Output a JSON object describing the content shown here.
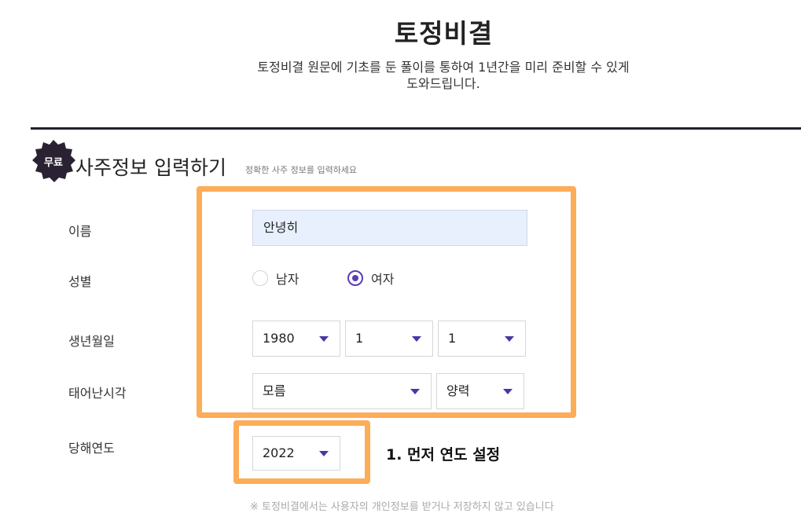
{
  "header": {
    "title": "토정비결",
    "description_line1": "토정비결 원문에 기초를 둔 풀이를 통하여 1년간을 미리 준비할 수 있게",
    "description_line2": "도와드립니다."
  },
  "section": {
    "badge": "무료",
    "title": "사주정보 입력하기",
    "subtitle": "정확한 사주 정보를 입력하세요",
    "badge_color": "#2a2233"
  },
  "form": {
    "name": {
      "label": "이름",
      "value": "안녕히"
    },
    "gender": {
      "label": "성별",
      "options": [
        {
          "label": "남자",
          "checked": false
        },
        {
          "label": "여자",
          "checked": true
        }
      ]
    },
    "birthdate": {
      "label": "생년월일",
      "year": "1980",
      "month": "1",
      "day": "1"
    },
    "birthtime": {
      "label": "태어난시각",
      "time": "모름",
      "calendar": "양력"
    },
    "target_year": {
      "label": "당해연도",
      "value": "2022"
    }
  },
  "annotation": {
    "text": "1. 먼저 연도 설정",
    "highlight_color": "#fdac58"
  },
  "footnote": "※ 토정비결에서는 사용자의 개인정보를 받거나 저장하지 않고 있습니다"
}
